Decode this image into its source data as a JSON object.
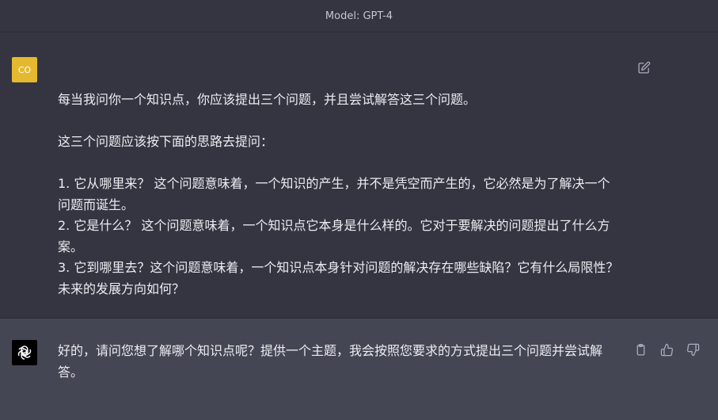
{
  "header": {
    "model_label": "Model: GPT-4"
  },
  "messages": {
    "user": {
      "avatar_text": "CO",
      "text": "每当我问你一个知识点，你应该提出三个问题，并且尝试解答这三个问题。\n\n这三个问题应该按下面的思路去提问：\n\n1. 它从哪里来？ 这个问题意味着，一个知识的产生，并不是凭空而产生的，它必然是为了解决一个问题而诞生。\n2. 它是什么？ 这个问题意味着，一个知识点它本身是什么样的。它对于要解决的问题提出了什么方案。\n3. 它到哪里去？这个问题意味着，一个知识点本身针对问题的解决存在哪些缺陷？它有什么局限性？未来的发展方向如何？",
      "icons": [
        "edit-icon"
      ]
    },
    "assistant": {
      "text": "好的，请问您想了解哪个知识点呢？提供一个主题，我会按照您要求的方式提出三个问题并尝试解答。",
      "icons": [
        "clipboard-icon",
        "thumbs-up-icon",
        "thumbs-down-icon"
      ]
    }
  },
  "colors": {
    "background": "#343541",
    "assistant_background": "#444654",
    "user_avatar": "#E4B92F",
    "text": "#ECECF1"
  }
}
